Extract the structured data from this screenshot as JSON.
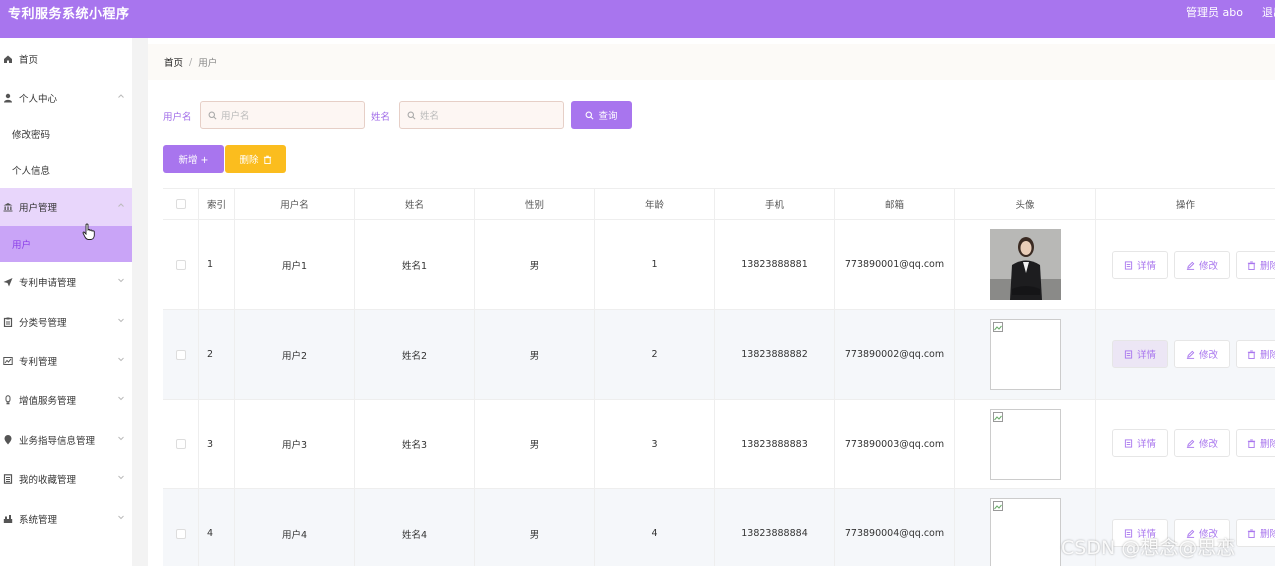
{
  "header": {
    "app_title": "专利服务系统小程序",
    "admin_label": "管理员 abo",
    "logout_label": "退出"
  },
  "sidebar": {
    "items": [
      {
        "label": "首页",
        "icon": "home-icon"
      },
      {
        "label": "个人中心",
        "icon": "user-icon",
        "expanded": true
      },
      {
        "label": "修改密码",
        "sub": true
      },
      {
        "label": "个人信息",
        "sub": true
      },
      {
        "label": "用户管理",
        "icon": "bank-icon",
        "expanded": true,
        "active": true
      },
      {
        "label": "用户",
        "sub": true,
        "active": true
      },
      {
        "label": "专利申请管理",
        "icon": "send-icon"
      },
      {
        "label": "分类号管理",
        "icon": "clipboard-icon"
      },
      {
        "label": "专利管理",
        "icon": "chart-icon"
      },
      {
        "label": "增值服务管理",
        "icon": "bulb-icon"
      },
      {
        "label": "业务指导信息管理",
        "icon": "location-icon"
      },
      {
        "label": "我的收藏管理",
        "icon": "list-icon"
      },
      {
        "label": "系统管理",
        "icon": "tools-icon"
      }
    ]
  },
  "breadcrumb": {
    "home": "首页",
    "separator": "/",
    "current": "用户"
  },
  "search": {
    "username_label": "用户名",
    "username_placeholder": "用户名",
    "name_label": "姓名",
    "name_placeholder": "姓名",
    "query_button": "查询"
  },
  "actions": {
    "add_button": "新增 +",
    "delete_button": "删除"
  },
  "table": {
    "headers": [
      "索引",
      "用户名",
      "姓名",
      "性别",
      "年龄",
      "手机",
      "邮箱",
      "头像",
      "操作"
    ],
    "rows": [
      {
        "index": "1",
        "username": "用户1",
        "name": "姓名1",
        "gender": "男",
        "age": "1",
        "phone": "13823888881",
        "email": "773890001@qq.com"
      },
      {
        "index": "2",
        "username": "用户2",
        "name": "姓名2",
        "gender": "男",
        "age": "2",
        "phone": "13823888882",
        "email": "773890002@qq.com"
      },
      {
        "index": "3",
        "username": "用户3",
        "name": "姓名3",
        "gender": "男",
        "age": "3",
        "phone": "13823888883",
        "email": "773890003@qq.com"
      },
      {
        "index": "4",
        "username": "用户4",
        "name": "姓名4",
        "gender": "男",
        "age": "4",
        "phone": "13823888884",
        "email": "773890004@qq.com"
      }
    ],
    "op_labels": {
      "detail": "详情",
      "edit": "修改",
      "delete": "删除"
    }
  },
  "watermark": "CSDN @想念@思恋",
  "colors": {
    "primary": "#a875ee",
    "warning": "#fbbd1e",
    "active_bg": "#c9a4f7"
  }
}
